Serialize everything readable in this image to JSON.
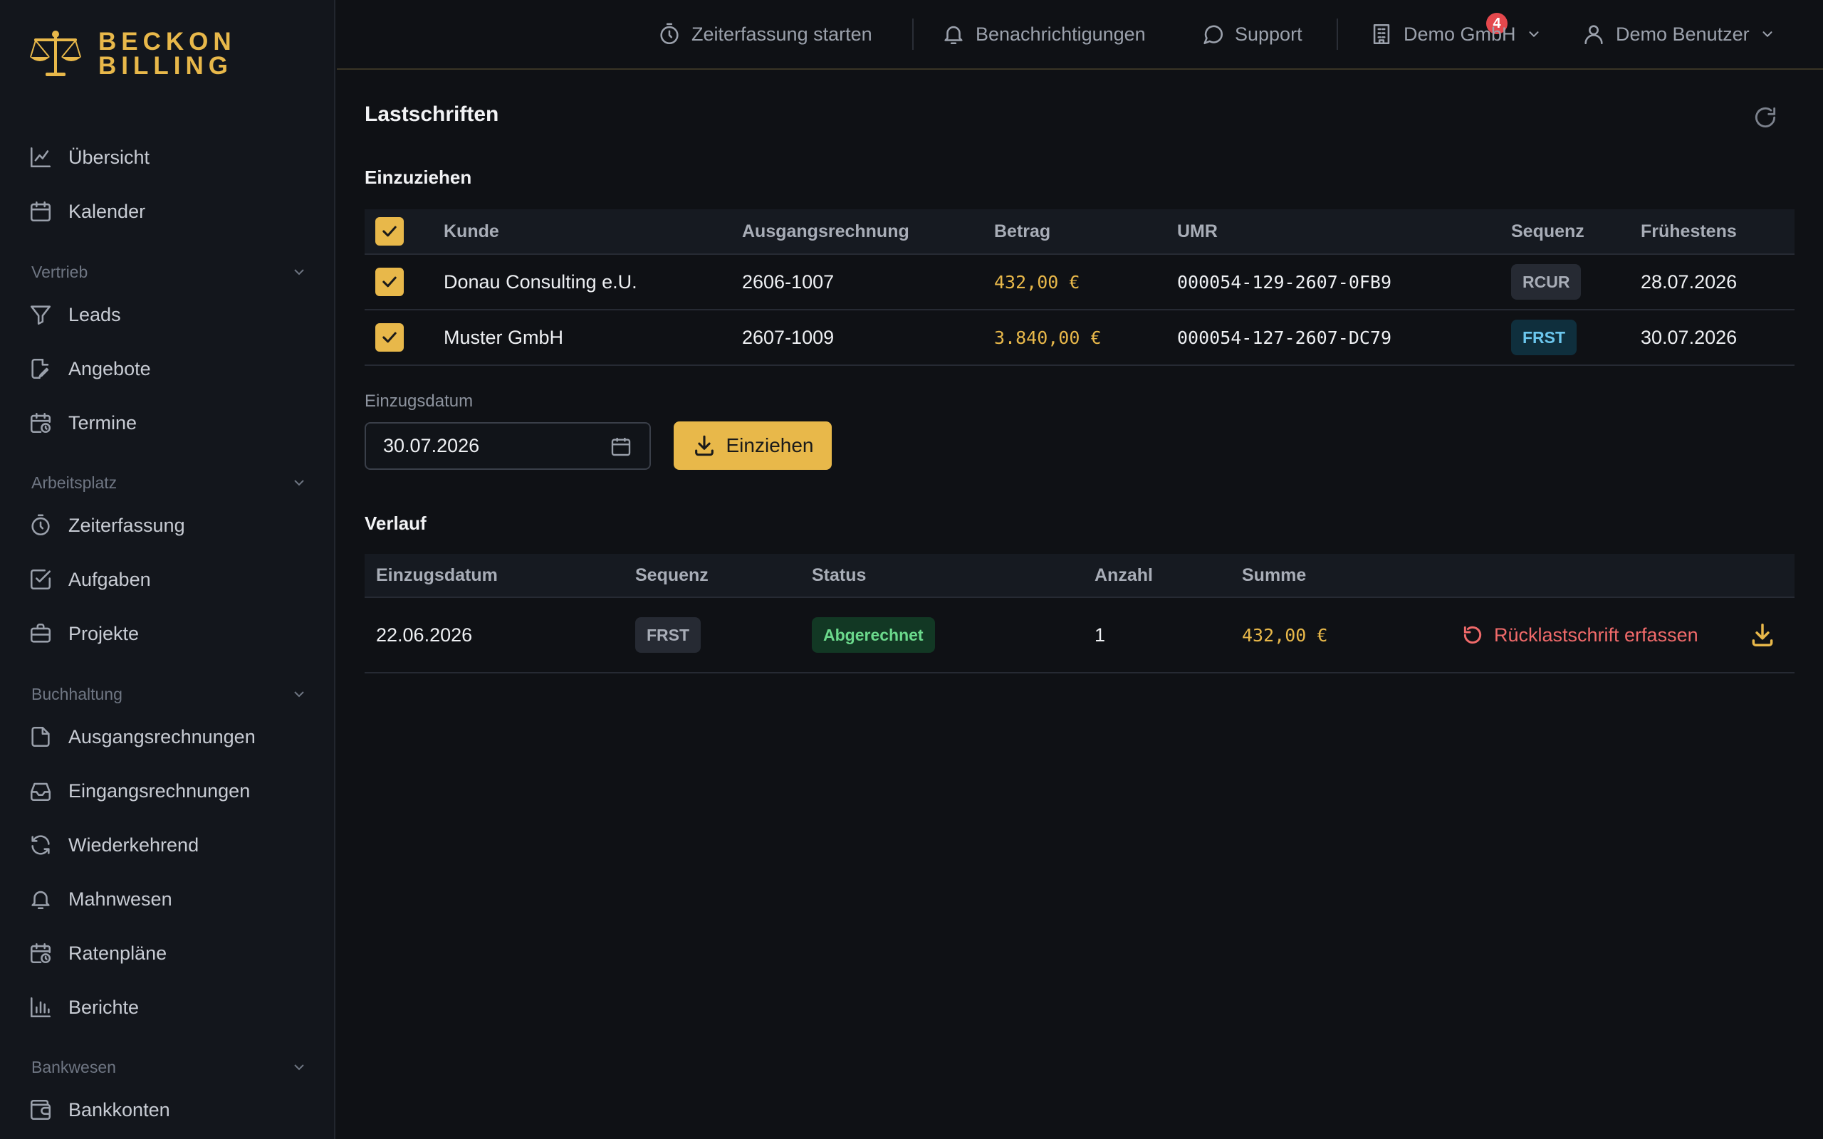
{
  "brand": {
    "line1": "BECKON",
    "line2": "BILLING",
    "accent": "#e8b84a"
  },
  "header": {
    "time_tracking": "Zeiterfassung starten",
    "notifications": "Benachrichtigungen",
    "notification_count": "4",
    "support": "Support",
    "company": "Demo GmbH",
    "user": "Demo Benutzer"
  },
  "sidebar": {
    "overview": "Übersicht",
    "calendar": "Kalender",
    "section_sales": "Vertrieb",
    "leads": "Leads",
    "quotes": "Angebote",
    "appointments": "Termine",
    "section_workspace": "Arbeitsplatz",
    "time": "Zeiterfassung",
    "tasks": "Aufgaben",
    "projects": "Projekte",
    "section_accounting": "Buchhaltung",
    "outgoing": "Ausgangsrechnungen",
    "incoming": "Eingangsrechnungen",
    "recurring": "Wiederkehrend",
    "dunning": "Mahnwesen",
    "installments": "Ratenpläne",
    "reports": "Berichte",
    "section_banking": "Bankwesen",
    "bank_accounts": "Bankkonten"
  },
  "page": {
    "title": "Lastschriften",
    "collect_title": "Einzuziehen",
    "history_title": "Verlauf"
  },
  "collect_table": {
    "headers": {
      "customer": "Kunde",
      "invoice": "Ausgangsrechnung",
      "amount": "Betrag",
      "umr": "UMR",
      "sequence": "Sequenz",
      "earliest": "Frühestens"
    },
    "rows": [
      {
        "customer": "Donau Consulting e.U.",
        "invoice": "2606-1007",
        "amount": "432,00 €",
        "umr": "000054-129-2607-0FB9",
        "sequence": "RCUR",
        "earliest": "28.07.2026",
        "checked": true
      },
      {
        "customer": "Muster GmbH",
        "invoice": "2607-1009",
        "amount": "3.840,00 €",
        "umr": "000054-127-2607-DC79",
        "sequence": "FRST",
        "earliest": "30.07.2026",
        "checked": true
      }
    ]
  },
  "collect_form": {
    "date_label": "Einzugsdatum",
    "date_value": "30.07.2026",
    "submit_label": "Einziehen"
  },
  "history_table": {
    "headers": {
      "date": "Einzugsdatum",
      "sequence": "Sequenz",
      "status": "Status",
      "count": "Anzahl",
      "sum": "Summe"
    },
    "rows": [
      {
        "date": "22.06.2026",
        "sequence": "FRST",
        "status": "Abgerechnet",
        "count": "1",
        "sum": "432,00 €",
        "action": "Rücklastschrift erfassen"
      }
    ]
  }
}
